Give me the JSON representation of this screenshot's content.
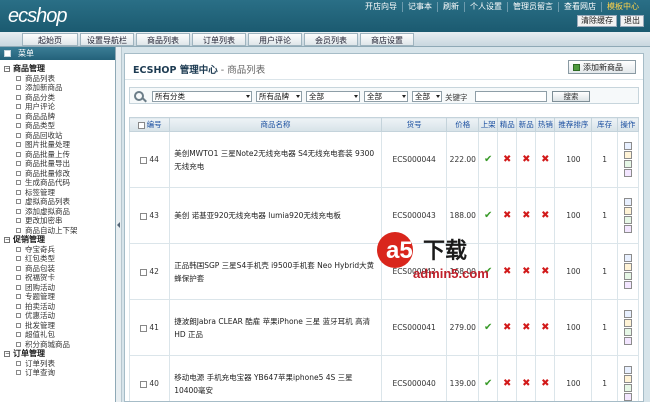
{
  "app": {
    "logo": "ecshop"
  },
  "top_links": [
    "开店向导",
    "记事本",
    "刷新",
    "个人设置",
    "管理员留言",
    "查看网店",
    "模板中心"
  ],
  "top_buttons": [
    "清除缓存",
    "退出"
  ],
  "nav_tabs": [
    "起始页",
    "设置导航栏",
    "商品列表",
    "订单列表",
    "用户评论",
    "会员列表",
    "商店设置"
  ],
  "sidebar": {
    "header": "菜单",
    "groups": [
      {
        "label": "商品管理",
        "items": [
          "商品列表",
          "添加新商品",
          "商品分类",
          "用户评论",
          "商品品牌",
          "商品类型",
          "商品回收站",
          "图片批量处理",
          "商品批量上传",
          "商品批量导出",
          "商品批量修改",
          "生成商品代码",
          "标签管理",
          "虚拟商品列表",
          "添加虚拟商品",
          "更改加密串",
          "商品自动上下架"
        ]
      },
      {
        "label": "促销管理",
        "items": [
          "夺宝奇兵",
          "红包类型",
          "商品包装",
          "祝福贺卡",
          "团购活动",
          "专题管理",
          "拍卖活动",
          "优惠活动",
          "批发管理",
          "超值礼包",
          "积分商城商品"
        ]
      },
      {
        "label": "订单管理",
        "items": [
          "订单列表",
          "订单查询"
        ]
      }
    ]
  },
  "page": {
    "title": "ECSHOP 管理中心",
    "subtitle": " - 商品列表",
    "add_button": "添加新商品"
  },
  "filter": {
    "category": "所有分类",
    "brand": "所有品牌",
    "select3": "全部",
    "select4": "全部",
    "select5": "全部",
    "keyword_label": "关键字",
    "keyword_value": "",
    "search_button": "搜索"
  },
  "table": {
    "headers": [
      "编号",
      "商品名称",
      "货号",
      "价格",
      "上架",
      "精品",
      "新品",
      "热销",
      "推荐排序",
      "库存",
      "操作"
    ],
    "rows": [
      {
        "id": "44",
        "name": "美创MWTO1 三星Note2无线充电器 S4无线充电套装 9300无线充电",
        "sn": "ECS000044",
        "price": "222.00",
        "on_sale": true,
        "best": false,
        "new": false,
        "hot": false,
        "sort": "100",
        "stock": "1"
      },
      {
        "id": "43",
        "name": "美创 诺基亚920无线充电器 lumia920无线充电板",
        "sn": "ECS000043",
        "price": "188.00",
        "on_sale": true,
        "best": false,
        "new": false,
        "hot": false,
        "sort": "100",
        "stock": "1"
      },
      {
        "id": "42",
        "name": "正品韩国SGP 三星S4手机壳 i9500手机套 Neo Hybrid大黄蜂保护套",
        "sn": "ECS000042",
        "price": "168.00",
        "on_sale": true,
        "best": false,
        "new": false,
        "hot": false,
        "sort": "100",
        "stock": "1"
      },
      {
        "id": "41",
        "name": "捷波朗Jabra CLEAR 酷雇 苹果iPhone 三星 蓝牙耳机 高清HD 正品",
        "sn": "ECS000041",
        "price": "279.00",
        "on_sale": true,
        "best": false,
        "new": false,
        "hot": false,
        "sort": "100",
        "stock": "1"
      },
      {
        "id": "40",
        "name": "移动电源 手机充电宝器 YB647苹果iphone5 4S 三星 10400毫安",
        "sn": "ECS000040",
        "price": "139.00",
        "on_sale": true,
        "best": false,
        "new": false,
        "hot": false,
        "sort": "100",
        "stock": "1"
      }
    ]
  },
  "watermark": {
    "brand": "a5",
    "text": "下载",
    "site": "admin5.com"
  },
  "colors": {
    "topbar": "#1b5a70",
    "check": "#3a9b2a",
    "cross": "#d21a1a",
    "link": "#1a4fa0"
  }
}
